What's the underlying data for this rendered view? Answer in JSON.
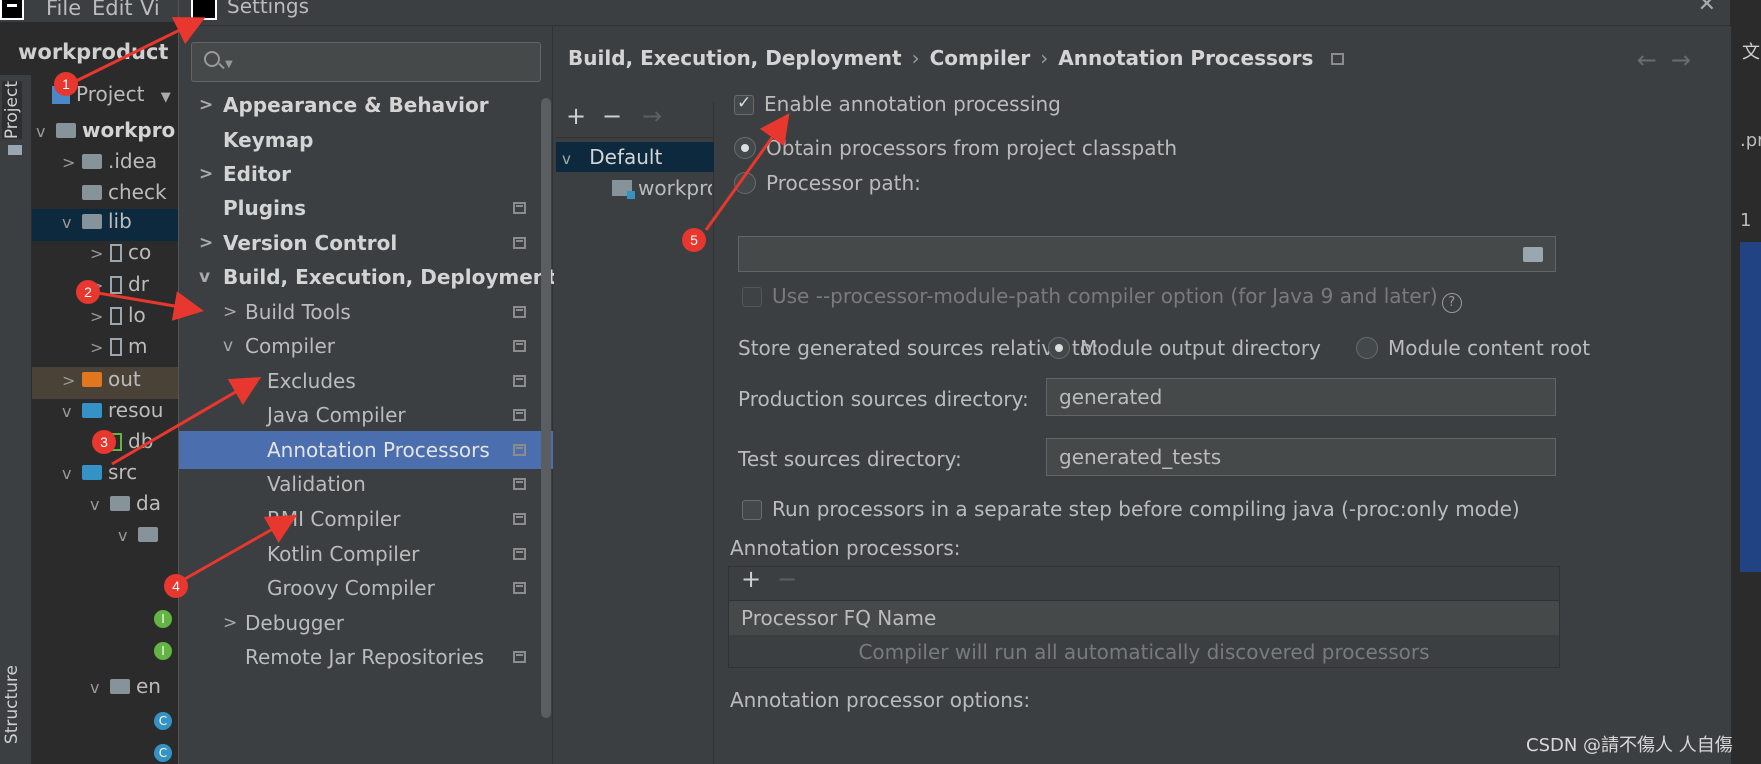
{
  "ide": {
    "menu": [
      "File",
      "Edit",
      "Vi"
    ],
    "project_name": "workproduct",
    "project_tab": "Project",
    "structure_tab": "Structure",
    "project_view_label": "Project",
    "tree": [
      {
        "label": "workpro",
        "kind": "module"
      },
      {
        "label": ".idea",
        "kind": "folder"
      },
      {
        "label": "check",
        "kind": "folder"
      },
      {
        "label": "lib",
        "kind": "folder"
      },
      {
        "label": "co",
        "kind": "jar"
      },
      {
        "label": "dr",
        "kind": "jar"
      },
      {
        "label": "lo",
        "kind": "jar"
      },
      {
        "label": "m",
        "kind": "jar"
      },
      {
        "label": "out",
        "kind": "folder-orange"
      },
      {
        "label": "resou",
        "kind": "folder-blue"
      },
      {
        "label": "db",
        "kind": "file"
      },
      {
        "label": "src",
        "kind": "folder-blue"
      },
      {
        "label": "da",
        "kind": "package"
      },
      {
        "label": "",
        "kind": "package"
      },
      {
        "label": "en",
        "kind": "package"
      }
    ],
    "right_sliver": {
      "top_label": "文",
      "tab_label": ".pr",
      "line_label": "1"
    }
  },
  "dialog": {
    "title": "Settings",
    "close_icon": "close-icon",
    "search": {
      "value": "",
      "placeholder": ""
    },
    "nav": [
      {
        "label": "Appearance & Behavior",
        "bold": true,
        "chevron": ">"
      },
      {
        "label": "Keymap",
        "bold": true,
        "chevron": ""
      },
      {
        "label": "Editor",
        "bold": true,
        "chevron": ">"
      },
      {
        "label": "Plugins",
        "bold": true,
        "chevron": "",
        "pin": true
      },
      {
        "label": "Version Control",
        "bold": true,
        "chevron": ">",
        "pin": true
      },
      {
        "label": "Build, Execution, Deployment",
        "bold": true,
        "chevron": "v"
      },
      {
        "label": "Build Tools",
        "bold": false,
        "chevron": ">",
        "pin": true
      },
      {
        "label": "Compiler",
        "bold": false,
        "chevron": "v",
        "pin": true
      },
      {
        "label": "Excludes",
        "bold": false,
        "chevron": "",
        "pin": true
      },
      {
        "label": "Java Compiler",
        "bold": false,
        "chevron": "",
        "pin": true
      },
      {
        "label": "Annotation Processors",
        "bold": false,
        "chevron": "",
        "pin": true,
        "selected": true
      },
      {
        "label": "Validation",
        "bold": false,
        "chevron": "",
        "pin": true
      },
      {
        "label": "RMI Compiler",
        "bold": false,
        "chevron": "",
        "pin": true
      },
      {
        "label": "Kotlin Compiler",
        "bold": false,
        "chevron": "",
        "pin": true
      },
      {
        "label": "Groovy Compiler",
        "bold": false,
        "chevron": "",
        "pin": true
      },
      {
        "label": "Debugger",
        "bold": false,
        "chevron": ">"
      },
      {
        "label": "Remote Jar Repositories",
        "bold": false,
        "chevron": "",
        "pin": true
      }
    ],
    "breadcrumb": [
      "Build, Execution, Deployment",
      "Compiler",
      "Annotation Processors"
    ],
    "breadcrumb_sep": "›",
    "back_arrow": "←",
    "forward_arrow": "→",
    "profiles": {
      "add": "+",
      "remove": "−",
      "move": "→",
      "default_label": "Default",
      "module_label": "workproduct"
    },
    "options": {
      "enable_label": "Enable annotation processing",
      "enable_checked": true,
      "obtain_label": "Obtain processors from project classpath",
      "processor_path_label": "Processor path:",
      "processor_path_value": "",
      "module_path_label": "Use --processor-module-path compiler option (for Java 9 and later)",
      "help_glyph": "?",
      "store_label": "Store generated sources relative to:",
      "module_output_label": "Module output directory",
      "module_content_label": "Module content root",
      "production_label": "Production sources directory:",
      "production_value": "generated",
      "test_label": "Test sources directory:",
      "test_value": "generated_tests",
      "separate_step_label": "Run processors in a separate step before compiling java (-proc:only mode)",
      "ap_section_label": "Annotation processors:",
      "ap_add": "+",
      "ap_remove": "−",
      "ap_column": "Processor FQ Name",
      "ap_empty": "Compiler will run all automatically discovered processors",
      "ap_options_label": "Annotation processor options:"
    }
  },
  "markers": [
    "1",
    "2",
    "3",
    "4",
    "5"
  ],
  "annotation_color": "#e8372e",
  "watermark": "CSDN @請不傷人 人自傷"
}
